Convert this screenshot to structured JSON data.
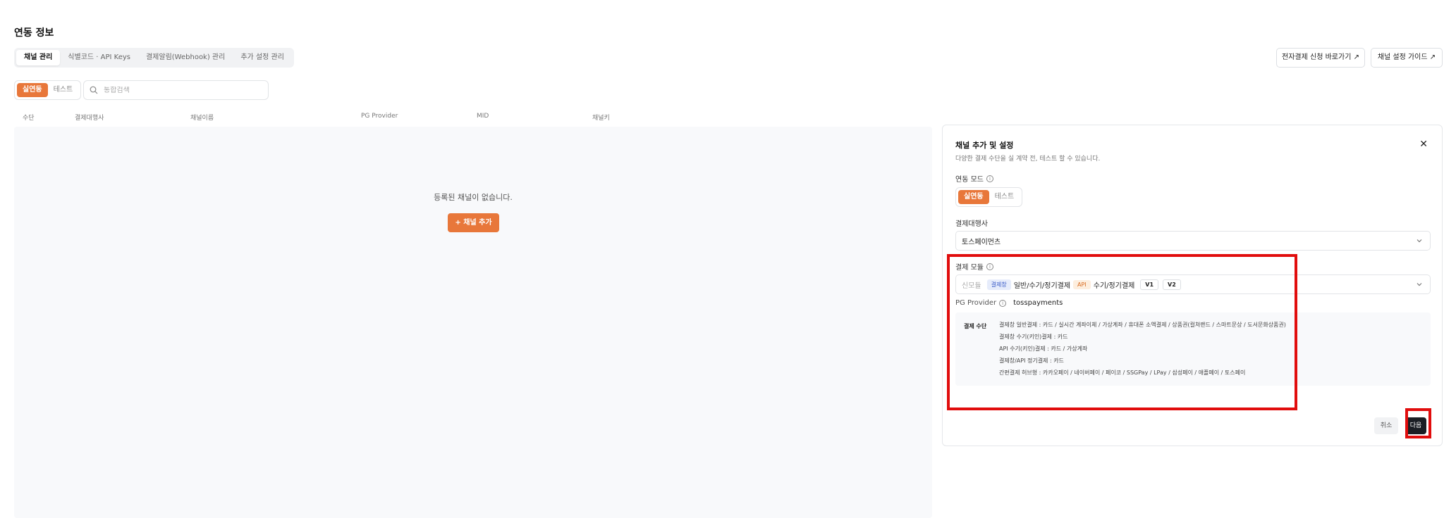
{
  "page": {
    "title": "연동 정보"
  },
  "tabs": [
    {
      "label": "채널 관리",
      "active": true
    },
    {
      "label": "식별코드 · API Keys",
      "active": false
    },
    {
      "label": "결제알림(Webhook) 관리",
      "active": false
    },
    {
      "label": "추가 설정 관리",
      "active": false
    }
  ],
  "header_buttons": {
    "guide1": "전자결제 신청 바로가기 ↗",
    "guide2": "채널 설정 가이드 ↗"
  },
  "mode_toggle": {
    "live": "실연동",
    "test": "테스트"
  },
  "search": {
    "placeholder": "통합검색",
    "value": ""
  },
  "table": {
    "columns": [
      "수단",
      "결제대행사",
      "채널이름",
      "PG Provider",
      "MID",
      "채널키"
    ],
    "empty_text": "등록된 채널이 없습니다.",
    "add_button": "+ 채널 추가"
  },
  "panel": {
    "title": "채널 추가 및 설정",
    "subtitle": "다양한 결제 수단을 실 계약 전, 테스트 할 수 있습니다.",
    "close": "✕",
    "mode_label": "연동 모드",
    "mode_live": "실연동",
    "mode_test": "테스트",
    "pg_label": "결제대행사",
    "pg_value": "토스페이먼츠",
    "module_label": "결제 모듈",
    "module": {
      "new": "신모듈",
      "badge1": "결제창",
      "text1": "일반/수기/정기결제",
      "badge2": "API",
      "text2": "수기/정기결제",
      "v1": "V1",
      "v2": "V2"
    },
    "pg_provider_label": "PG Provider",
    "pg_provider_value": "tosspayments",
    "methods_title": "결제 수단",
    "methods": [
      "결제창 일반결제 : 카드 / 실시간 계좌이체 / 가상계좌 / 휴대폰 소액결제 / 상품권(컬쳐랜드 / 스마트문상 / 도서문화상품권)",
      "결제창 수기(키인)결제 : 카드",
      "API 수기(키인)결제 : 카드 / 가상계좌",
      "결제창/API 정기결제 : 카드",
      "간편결제 허브형 : 카카오페이 / 네이버페이 / 페이코 / SSGPay / LPay / 삼성페이 / 애플페이 / 토스페이"
    ],
    "cancel": "취소",
    "next": "다음"
  },
  "colors": {
    "accent": "#e8773a",
    "highlight": "#e10d0d",
    "next_button": "#1b1e24"
  }
}
